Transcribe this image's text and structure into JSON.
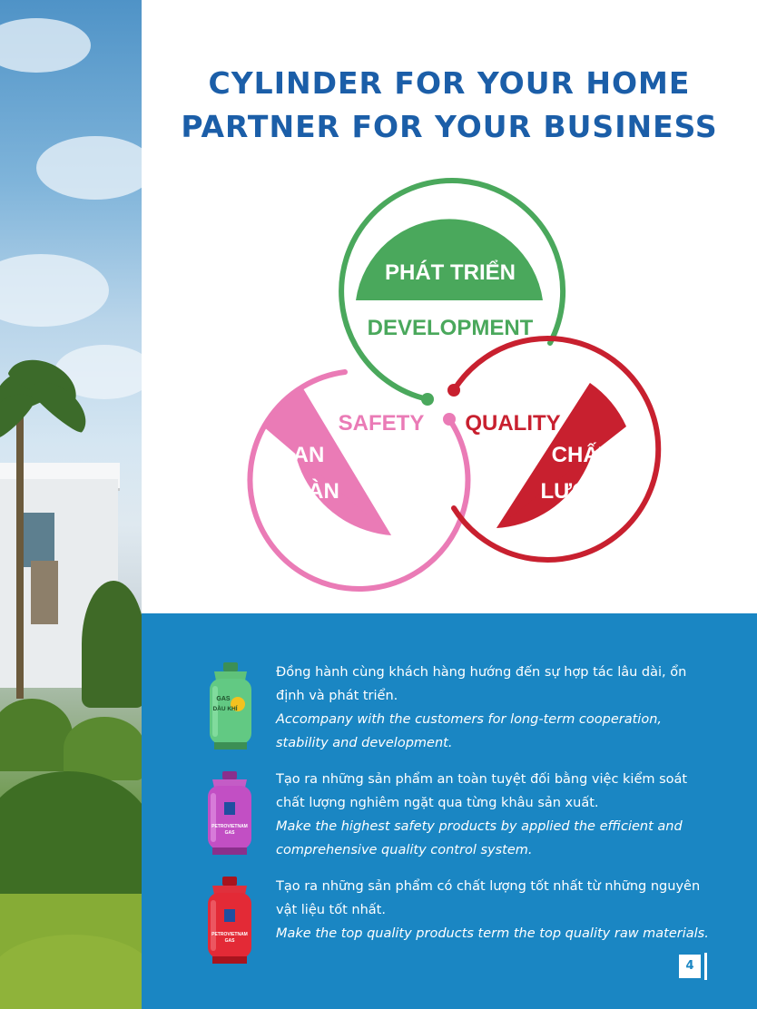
{
  "headline": {
    "line1": "CYLINDER FOR YOUR HOME",
    "line2": "PARTNER FOR YOUR BUSINESS"
  },
  "diagram": {
    "development": {
      "vn": "PHÁT TRIỂN",
      "en": "DEVELOPMENT",
      "color": "#4aa85c"
    },
    "safety": {
      "vn_line1": "AN",
      "vn_line2": "TOÀN",
      "en": "SAFETY",
      "color": "#ea7bb6"
    },
    "quality": {
      "vn_line1": "CHẤT",
      "vn_line2": "LƯỢNG",
      "en": "QUALITY",
      "color": "#c8202f"
    }
  },
  "commitments": [
    {
      "icon": "green-gas-cylinder-icon",
      "vn": "Đồng hành cùng khách hàng hướng đến sự hợp tác lâu dài, ổn định và phát triển.",
      "en": "Accompany with the customers for long-term cooperation, stability and development.",
      "label_line1": "GAS",
      "label_line2": "DẦU KHÍ"
    },
    {
      "icon": "purple-gas-cylinder-icon",
      "vn": "Tạo ra những sản phẩm an toàn tuyệt đối bằng việc kiểm soát chất lượng nghiêm ngặt qua từng khâu sản xuất.",
      "en": "Make the highest safety products by applied the efficient and comprehensive quality control system.",
      "label_line1": "PETROVIETNAM",
      "label_line2": "GAS"
    },
    {
      "icon": "red-gas-cylinder-icon",
      "vn": "Tạo ra những sản phẩm có chất lượng tốt nhất từ những nguyên vật liệu tốt nhất.",
      "en": "Make the top quality products term the top quality raw materials.",
      "label_line1": "PETROVIETNAM",
      "label_line2": "GAS"
    }
  ],
  "page_number": "4",
  "colors": {
    "headline": "#1b5ea8",
    "panel": "#1a86c3"
  }
}
